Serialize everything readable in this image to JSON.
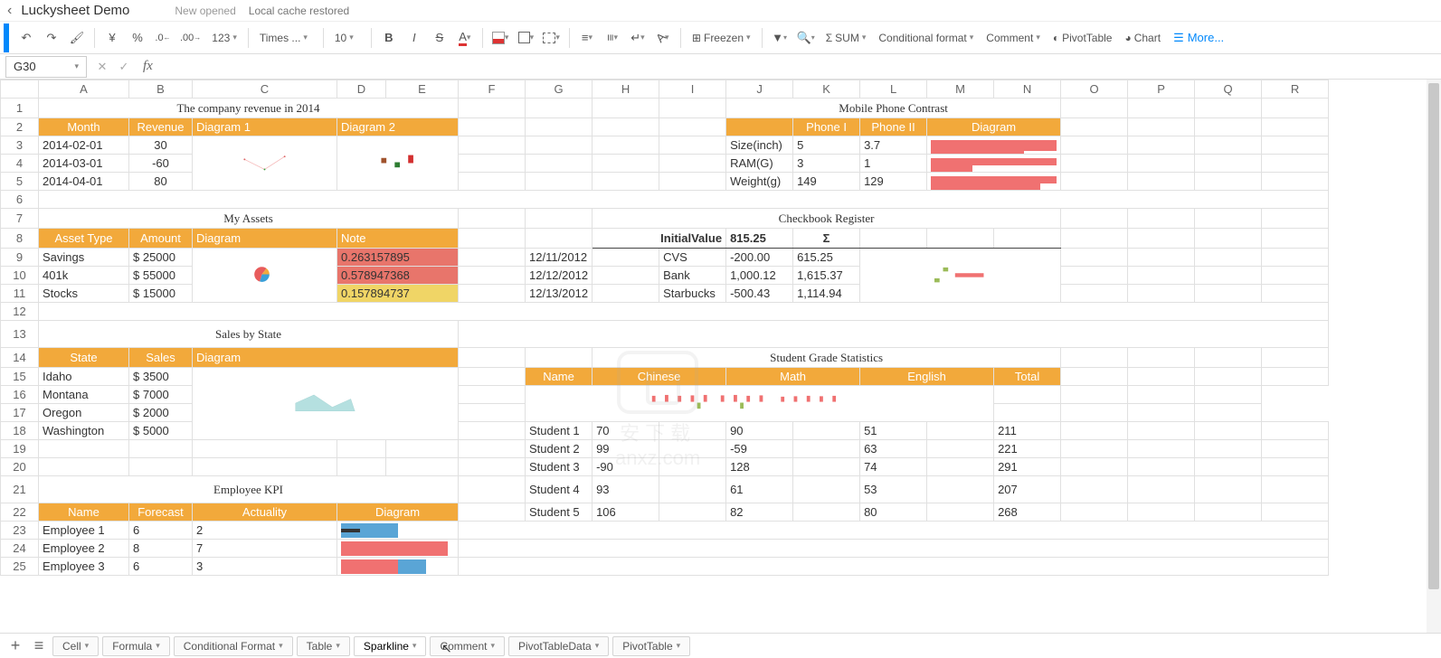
{
  "titlebar": {
    "title": "Luckysheet Demo",
    "subtitle_a": "New opened",
    "subtitle_b": "Local cache restored"
  },
  "toolbar": {
    "currency": "¥",
    "percent": "%",
    "dec_dec": ".0",
    "dec_inc": ".00",
    "num": "123",
    "font": "Times ...",
    "size": "10",
    "freeze": "Freezen",
    "sum": "SUM",
    "condfmt": "Conditional format",
    "comment": "Comment",
    "pivot": "PivotTable",
    "chart": "Chart",
    "more": "More..."
  },
  "formula": {
    "cellref": "G30"
  },
  "columns": [
    "A",
    "B",
    "C",
    "D",
    "E",
    "F",
    "G",
    "H",
    "I",
    "J",
    "K",
    "L",
    "M",
    "N",
    "O",
    "P",
    "Q",
    "R"
  ],
  "titles": {
    "revenue": "The company revenue in 2014",
    "mobile": "Mobile Phone Contrast",
    "assets": "My Assets",
    "checkbook": "Checkbook Register",
    "sales": "Sales by State",
    "grades": "Student Grade Statistics",
    "kpi": "Employee KPI"
  },
  "revenue": {
    "h_month": "Month",
    "h_rev": "Revenue",
    "h_d1": "Diagram 1",
    "h_d2": "Diagram 2",
    "rows": [
      {
        "m": "2014-02-01",
        "r": "30"
      },
      {
        "m": "2014-03-01",
        "r": "-60"
      },
      {
        "m": "2014-04-01",
        "r": "80"
      }
    ]
  },
  "mobile": {
    "h_p1": "Phone I",
    "h_p2": "Phone II",
    "h_d": "Diagram",
    "rows": [
      {
        "k": "Size(inch)",
        "a": "5",
        "b": "3.7"
      },
      {
        "k": "RAM(G)",
        "a": "3",
        "b": "1"
      },
      {
        "k": "Weight(g)",
        "a": "149",
        "b": "129"
      }
    ]
  },
  "assets": {
    "h_type": "Asset Type",
    "h_amt": "Amount",
    "h_d": "Diagram",
    "h_note": "Note",
    "rows": [
      {
        "t": "Savings",
        "a": "$ 25000",
        "n": "0.263157895"
      },
      {
        "t": "401k",
        "a": "$ 55000",
        "n": "0.578947368"
      },
      {
        "t": "Stocks",
        "a": "$ 15000",
        "n": "0.157894737"
      }
    ]
  },
  "checkbook": {
    "h_init": "InitialValue",
    "h_initv": "815.25",
    "h_sigma": "Σ",
    "rows": [
      {
        "d": "12/11/2012",
        "p": "CVS",
        "a": "-200.00",
        "b": "615.25"
      },
      {
        "d": "12/12/2012",
        "p": "Bank",
        "a": "1,000.12",
        "b": "1,615.37"
      },
      {
        "d": "12/13/2012",
        "p": "Starbucks",
        "a": "-500.43",
        "b": "1,114.94"
      }
    ]
  },
  "sales": {
    "h_state": "State",
    "h_sales": "Sales",
    "h_d": "Diagram",
    "rows": [
      {
        "s": "Idaho",
        "v": "$ 3500"
      },
      {
        "s": "Montana",
        "v": "$ 7000"
      },
      {
        "s": "Oregon",
        "v": "$ 2000"
      },
      {
        "s": "Washington",
        "v": "$ 5000"
      }
    ]
  },
  "grades": {
    "h_name": "Name",
    "h_cn": "Chinese",
    "h_math": "Math",
    "h_en": "English",
    "h_total": "Total",
    "rows": [
      {
        "n": "Student 1",
        "c": "70",
        "m": "90",
        "e": "51",
        "t": "211"
      },
      {
        "n": "Student 2",
        "c": "99",
        "m": "-59",
        "e": "63",
        "t": "221"
      },
      {
        "n": "Student 3",
        "c": "-90",
        "m": "128",
        "e": "74",
        "t": "291"
      },
      {
        "n": "Student 4",
        "c": "93",
        "m": "61",
        "e": "53",
        "t": "207"
      },
      {
        "n": "Student 5",
        "c": "106",
        "m": "82",
        "e": "80",
        "t": "268"
      }
    ]
  },
  "kpi": {
    "h_name": "Name",
    "h_fc": "Forecast",
    "h_act": "Actuality",
    "h_d": "Diagram",
    "rows": [
      {
        "n": "Employee 1",
        "f": "6",
        "a": "2"
      },
      {
        "n": "Employee 2",
        "f": "8",
        "a": "7"
      },
      {
        "n": "Employee 3",
        "f": "6",
        "a": "3"
      }
    ]
  },
  "tabs": [
    "Cell",
    "Formula",
    "Conditional Format",
    "Table",
    "Sparkline",
    "Comment",
    "PivotTableData",
    "PivotTable"
  ],
  "active_tab": "Sparkline",
  "watermark": "anxz.com",
  "chart_data": [
    {
      "type": "line",
      "name": "revenue-diagram1",
      "categories": [
        "2014-02-01",
        "2014-03-01",
        "2014-04-01"
      ],
      "values": [
        30,
        -60,
        80
      ]
    },
    {
      "type": "bar",
      "name": "revenue-diagram2",
      "categories": [
        "2014-02-01",
        "2014-03-01",
        "2014-04-01"
      ],
      "values": [
        30,
        -60,
        80
      ]
    },
    {
      "type": "bar",
      "name": "mobile-size",
      "series": [
        {
          "name": "Phone I",
          "values": [
            5
          ]
        },
        {
          "name": "Phone II",
          "values": [
            3.7
          ]
        }
      ]
    },
    {
      "type": "bar",
      "name": "mobile-ram",
      "series": [
        {
          "name": "Phone I",
          "values": [
            3
          ]
        },
        {
          "name": "Phone II",
          "values": [
            1
          ]
        }
      ]
    },
    {
      "type": "bar",
      "name": "mobile-weight",
      "series": [
        {
          "name": "Phone I",
          "values": [
            149
          ]
        },
        {
          "name": "Phone II",
          "values": [
            129
          ]
        }
      ]
    },
    {
      "type": "pie",
      "name": "assets-pie",
      "categories": [
        "Savings",
        "401k",
        "Stocks"
      ],
      "values": [
        25000,
        55000,
        15000
      ]
    },
    {
      "type": "area",
      "name": "sales-area",
      "categories": [
        "Idaho",
        "Montana",
        "Oregon",
        "Washington"
      ],
      "values": [
        3500,
        7000,
        2000,
        5000
      ]
    },
    {
      "type": "bar",
      "name": "checkbook-winloss",
      "categories": [
        "12/11",
        "12/12",
        "12/13"
      ],
      "values": [
        -200,
        1000.12,
        -500.43
      ]
    },
    {
      "type": "bar",
      "name": "grades-columns",
      "series": [
        {
          "name": "Chinese",
          "values": [
            70,
            99,
            -90,
            93,
            106
          ]
        },
        {
          "name": "Math",
          "values": [
            90,
            -59,
            128,
            61,
            82
          ]
        },
        {
          "name": "English",
          "values": [
            51,
            63,
            74,
            53,
            80
          ]
        }
      ]
    },
    {
      "type": "bar",
      "name": "kpi-bullet",
      "series": [
        {
          "name": "Forecast",
          "values": [
            6,
            8,
            6
          ]
        },
        {
          "name": "Actuality",
          "values": [
            2,
            7,
            3
          ]
        }
      ]
    }
  ]
}
